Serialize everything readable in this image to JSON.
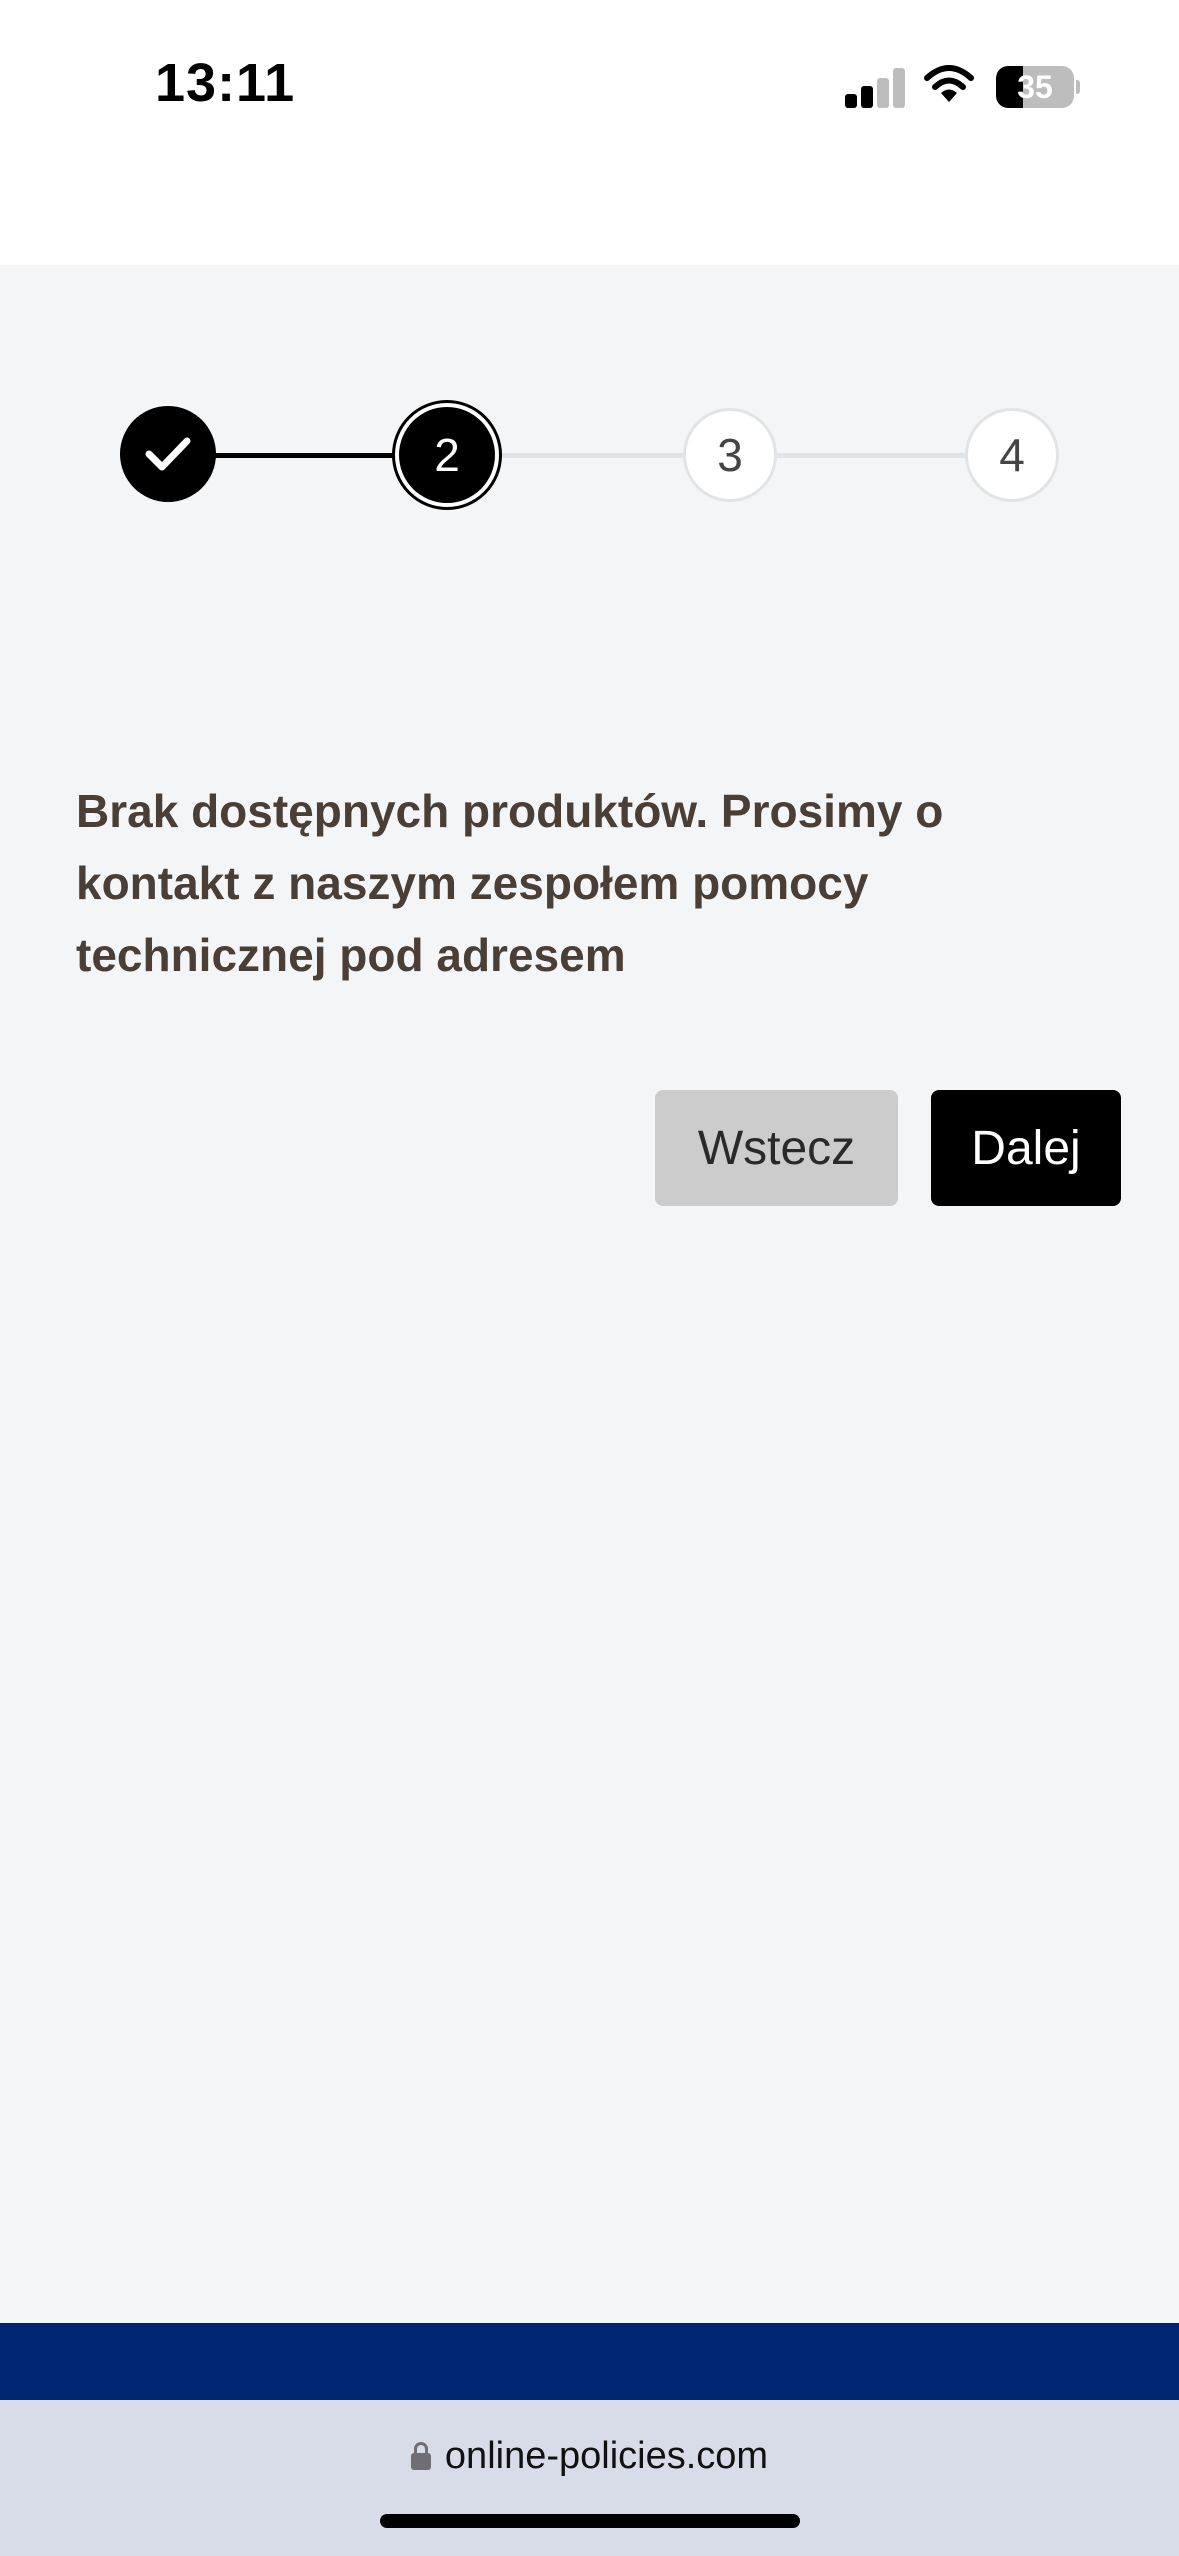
{
  "status_bar": {
    "time": "13:11",
    "battery_level": "35",
    "battery_fraction": 0.35,
    "signal_bars_active": 2,
    "signal_bars_total": 4
  },
  "stepper": {
    "current_step": 2,
    "steps": [
      {
        "label": "",
        "state": "completed",
        "icon": "check-icon"
      },
      {
        "label": "2",
        "state": "active"
      },
      {
        "label": "3",
        "state": "upcoming"
      },
      {
        "label": "4",
        "state": "upcoming"
      }
    ]
  },
  "main": {
    "message": "Brak dostępnych produktów. Prosimy o kontakt z naszym zespołem pomocy technicznej pod adresem"
  },
  "actions": {
    "back_label": "Wstecz",
    "next_label": "Dalej"
  },
  "browser": {
    "url": "online-policies.com",
    "lock_icon": "lock-icon"
  },
  "colors": {
    "background": "#f4f5f7",
    "footer_band": "#002673",
    "browser_bar": "#d7dce8",
    "message_text": "#4a3f36",
    "button_next_bg": "#000000",
    "button_back_bg": "#cccccc"
  }
}
